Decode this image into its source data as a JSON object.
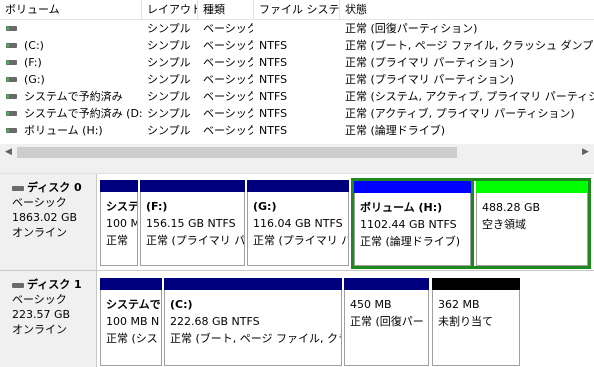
{
  "columns": [
    "ボリューム",
    "レイアウト",
    "種類",
    "ファイル システム",
    "状態"
  ],
  "volumes": [
    {
      "name": "",
      "layout": "シンプル",
      "type": "ベーシック",
      "fs": "",
      "status": "正常 (回復パーティション)"
    },
    {
      "name": "(C:)",
      "layout": "シンプル",
      "type": "ベーシック",
      "fs": "NTFS",
      "status": "正常 (ブート, ページ ファイル, クラッシュ ダンプ, プライマリ"
    },
    {
      "name": "(F:)",
      "layout": "シンプル",
      "type": "ベーシック",
      "fs": "NTFS",
      "status": "正常 (プライマリ パーティション)"
    },
    {
      "name": "(G:)",
      "layout": "シンプル",
      "type": "ベーシック",
      "fs": "NTFS",
      "status": "正常 (プライマリ パーティション)"
    },
    {
      "name": "システムで予約済み",
      "layout": "シンプル",
      "type": "ベーシック",
      "fs": "NTFS",
      "status": "正常 (システム, アクティブ, プライマリ パーティション)"
    },
    {
      "name": "システムで予約済み (D:)",
      "layout": "シンプル",
      "type": "ベーシック",
      "fs": "NTFS",
      "status": "正常 (アクティブ, プライマリ パーティション)"
    },
    {
      "name": "ボリューム (H:)",
      "layout": "シンプル",
      "type": "ベーシック",
      "fs": "NTFS",
      "status": "正常 (論理ドライブ)"
    }
  ],
  "scroll": {
    "left": "◀",
    "right": "▶"
  },
  "disks": [
    {
      "name": "ディスク 0",
      "type": "ベーシック",
      "size": "1863.02 GB",
      "state": "オンライン",
      "partitions": [
        {
          "title": "システ",
          "size": "100 M",
          "status": "正常",
          "color": "#00007f"
        },
        {
          "title": "(F:)",
          "size": "156.15 GB NTFS",
          "status": "正常 (プライマリ パ-",
          "color": "#00007f"
        },
        {
          "title": "(G:)",
          "size": "116.04 GB NTFS",
          "status": "正常 (プライマリ パ",
          "color": "#00007f"
        },
        {
          "title": "ボリューム (H:)",
          "size": "1102.44 GB NTFS",
          "status": "正常 (論理ドライブ)",
          "color": "#0000ff"
        },
        {
          "title": "",
          "size": "488.28 GB",
          "status": "空き領域",
          "color": "#00ff00"
        }
      ]
    },
    {
      "name": "ディスク 1",
      "type": "ベーシック",
      "size": "223.57 GB",
      "state": "オンライン",
      "partitions": [
        {
          "title": "システムで予",
          "size": "100 MB N",
          "status": "正常 (シス",
          "color": "#00007f"
        },
        {
          "title": "(C:)",
          "size": "222.68 GB NTFS",
          "status": "正常 (ブート, ページ ファイル, クラッシ",
          "color": "#00007f"
        },
        {
          "title": "",
          "size": "450 MB",
          "status": "正常 (回復パー",
          "color": "#00007f"
        },
        {
          "title": "",
          "size": "362 MB",
          "status": "未割り当て",
          "color": "#000000"
        }
      ]
    }
  ]
}
